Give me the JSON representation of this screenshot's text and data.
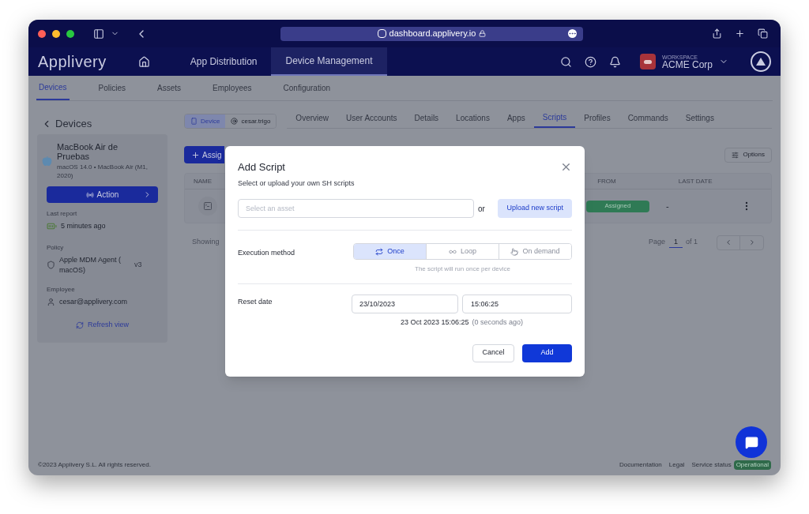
{
  "browser": {
    "url": "dashboard.applivery.io"
  },
  "app": {
    "logo": "Applivery",
    "nav": [
      {
        "label": "App Distribution",
        "selected": false
      },
      {
        "label": "Device Management",
        "selected": true
      }
    ],
    "workspace": {
      "caption": "WORKSPACE",
      "name": "ACME Corp"
    }
  },
  "subnav": [
    {
      "label": "Devices",
      "selected": true
    },
    {
      "label": "Policies",
      "selected": false
    },
    {
      "label": "Assets",
      "selected": false
    },
    {
      "label": "Employees",
      "selected": false
    },
    {
      "label": "Configuration",
      "selected": false
    }
  ],
  "back": "Devices",
  "device_card": {
    "name": "MacBook Air de Pruebas",
    "subtitle": "macOS 14.0 • MacBook Air (M1, 2020)",
    "action": "Action",
    "last_report_label": "Last report",
    "last_report": "5 minutes ago",
    "policy_label": "Policy",
    "policy": "Apple MDM Agent ( macOS)",
    "policy_version": "v3",
    "employee_label": "Employee",
    "employee": "cesar@applivery.com",
    "refresh": "Refresh view"
  },
  "identity": [
    {
      "label": "Device",
      "selected": true
    },
    {
      "label": "cesar.trigo",
      "selected": false
    }
  ],
  "tabs": [
    {
      "label": "Overview",
      "selected": false
    },
    {
      "label": "User Accounts",
      "selected": false
    },
    {
      "label": "Details",
      "selected": false
    },
    {
      "label": "Locations",
      "selected": false
    },
    {
      "label": "Apps",
      "selected": false
    },
    {
      "label": "Scripts",
      "selected": true
    },
    {
      "label": "Profiles",
      "selected": false
    },
    {
      "label": "Commands",
      "selected": false
    },
    {
      "label": "Settings",
      "selected": false
    }
  ],
  "assign_button": "Assig",
  "options_button": "Options",
  "table": {
    "columns": [
      "NAME",
      "FROM",
      "LAST DATE"
    ],
    "rows": [
      {
        "from": "Assigned",
        "last_date": "-"
      }
    ]
  },
  "pagination": {
    "showing": "Showing",
    "page_label": "Page",
    "page": "1",
    "of": "of 1"
  },
  "footer": {
    "copyright": "©2023 Applivery S.L. All rights reserved.",
    "links": [
      "Documentation",
      "Legal"
    ],
    "status_label": "Service status",
    "status": "Operational"
  },
  "modal": {
    "title": "Add Script",
    "subtitle": "Select or upload your own SH scripts",
    "asset_placeholder": "Select an asset",
    "or": "or",
    "upload": "Upload new script",
    "execution_label": "Execution method",
    "methods": [
      {
        "label": "Once",
        "selected": true
      },
      {
        "label": "Loop",
        "selected": false
      },
      {
        "label": "On demand",
        "selected": false
      }
    ],
    "method_hint": "The script will run once per device",
    "reset_label": "Reset date",
    "date": "23/10/2023",
    "time": "15:06:25",
    "summary": "23 Oct 2023 15:06:25",
    "summary_ago": "(0 seconds ago)",
    "cancel": "Cancel",
    "add": "Add"
  }
}
